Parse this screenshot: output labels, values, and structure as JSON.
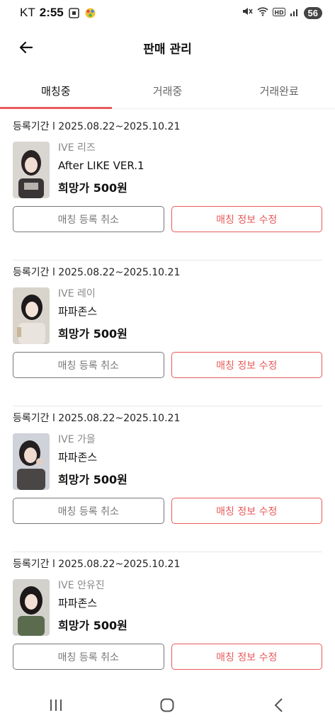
{
  "status_bar": {
    "carrier": "KT",
    "time": "2:55",
    "battery": "56"
  },
  "header": {
    "title": "판매 관리"
  },
  "tabs": [
    {
      "label": "매칭중",
      "active": true
    },
    {
      "label": "거래중",
      "active": false
    },
    {
      "label": "거래완료",
      "active": false
    }
  ],
  "listings": [
    {
      "period": "등록기간 l 2025.08.22~2025.10.21",
      "artist": "IVE 리즈",
      "album": "After LIKE VER.1",
      "price": "희망가 500원",
      "cancel_label": "매칭 등록 취소",
      "edit_label": "매칭 정보 수정"
    },
    {
      "period": "등록기간 l 2025.08.22~2025.10.21",
      "artist": "IVE 레이",
      "album": "파파존스",
      "price": "희망가 500원",
      "cancel_label": "매칭 등록 취소",
      "edit_label": "매칭 정보 수정"
    },
    {
      "period": "등록기간 l 2025.08.22~2025.10.21",
      "artist": "IVE 가을",
      "album": "파파존스",
      "price": "희망가 500원",
      "cancel_label": "매칭 등록 취소",
      "edit_label": "매칭 정보 수정"
    },
    {
      "period": "등록기간 l 2025.08.22~2025.10.21",
      "artist": "IVE 안유진",
      "album": "파파존스",
      "price": "희망가 500원",
      "cancel_label": "매칭 등록 취소",
      "edit_label": "매칭 정보 수정"
    }
  ],
  "colors": {
    "accent": "#e85a5a",
    "muted_border": "#777777"
  },
  "icons": {
    "back": "arrow-left-icon",
    "nav_recent": "recent-apps-icon",
    "nav_home": "home-icon",
    "nav_back": "chevron-left-icon"
  }
}
